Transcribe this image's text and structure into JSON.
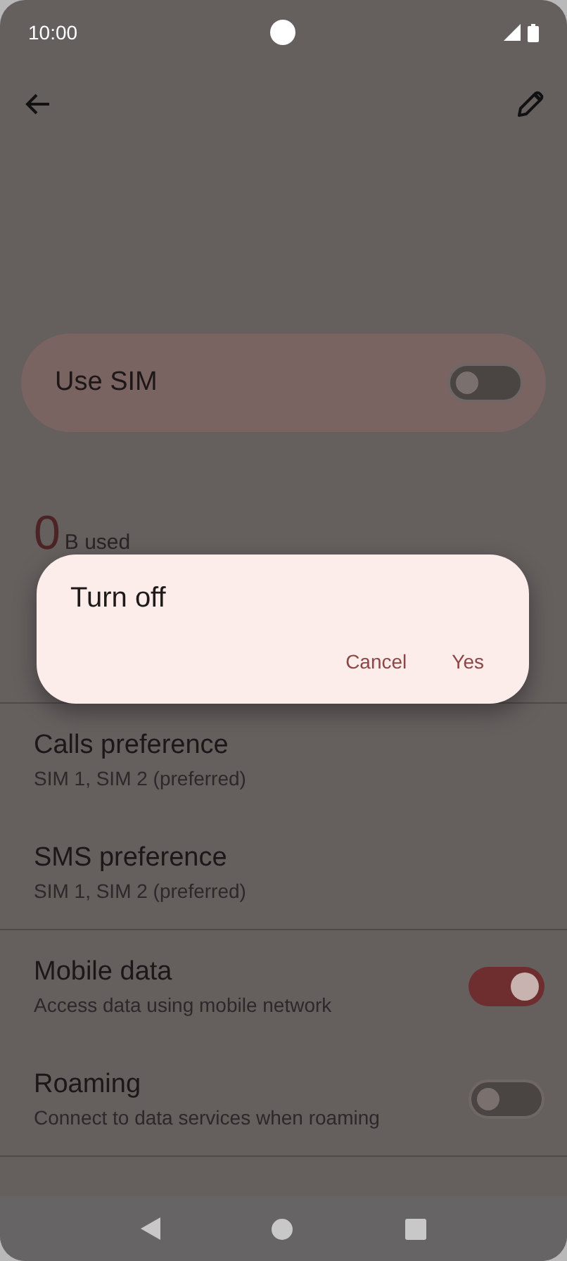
{
  "status_bar": {
    "time": "10:00"
  },
  "use_sim": {
    "label": "Use SIM",
    "on": false
  },
  "usage": {
    "amount": "0",
    "unit": "B used"
  },
  "settings": [
    {
      "kind": "link",
      "title": "Calls preference",
      "subtitle": "SIM 1, SIM 2 (preferred)"
    },
    {
      "kind": "link",
      "title": "SMS preference",
      "subtitle": "SIM 1, SIM 2 (preferred)"
    },
    {
      "kind": "switch",
      "title": "Mobile data",
      "subtitle": "Access data using mobile network",
      "on": true
    },
    {
      "kind": "switch",
      "title": "Roaming",
      "subtitle": "Connect to data services when roaming",
      "on": false
    }
  ],
  "dialog": {
    "title": "Turn off",
    "buttons": [
      "Cancel",
      "Yes"
    ]
  }
}
